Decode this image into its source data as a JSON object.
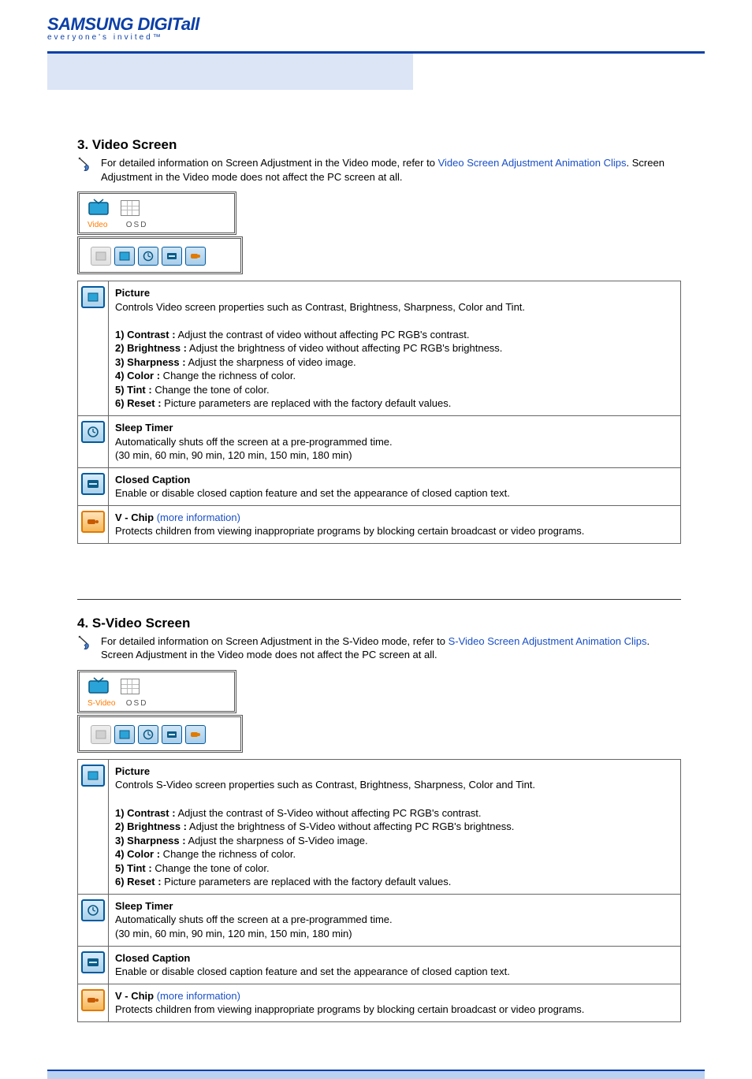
{
  "brand": {
    "logo_main": "SAMSUNG DIGITall",
    "logo_tag": "everyone's invited™"
  },
  "sections": [
    {
      "index": "3",
      "title": "Video Screen",
      "note_pre": "For detailed information on Screen Adjustment in the Video mode, refer to ",
      "note_link": "Video Screen Adjustment Animation Clips",
      "note_post": ". Screen Adjustment in the Video mode does not affect the PC screen at all.",
      "mode_label": "Video",
      "osd_label": "OSD",
      "features": {
        "picture": {
          "title": "Picture",
          "desc": "Controls Video screen properties such as Contrast, Brightness, Sharpness, Color and Tint.",
          "items": [
            {
              "label": "1) Contrast :",
              "text": " Adjust the contrast of video without affecting PC RGB's contrast."
            },
            {
              "label": "2) Brightness :",
              "text": " Adjust the brightness of video without affecting PC RGB's brightness."
            },
            {
              "label": "3) Sharpness :",
              "text": " Adjust the sharpness of video image."
            },
            {
              "label": "4) Color :",
              "text": " Change the richness of color."
            },
            {
              "label": "5) Tint :",
              "text": " Change the tone of color."
            },
            {
              "label": "6) Reset :",
              "text": " Picture parameters are replaced with the factory default values."
            }
          ]
        },
        "sleep": {
          "title": "Sleep Timer",
          "line1": "Automatically shuts off the screen at a pre-programmed time.",
          "line2": "(30 min, 60 min, 90 min, 120 min, 150 min, 180 min)"
        },
        "cc": {
          "title": "Closed Caption",
          "desc": "Enable or disable closed caption feature and set the appearance of closed caption text."
        },
        "vchip": {
          "title": "V - Chip ",
          "more": "(more information)",
          "desc": "Protects children from viewing inappropriate programs by blocking certain broadcast or video programs."
        }
      }
    },
    {
      "index": "4",
      "title": "S-Video Screen",
      "note_pre": "For detailed information on Screen Adjustment in the S-Video mode, refer to ",
      "note_link": "S-Video Screen Adjustment Animation Clips",
      "note_post": ". Screen Adjustment in the Video mode does not affect the PC screen at all.",
      "mode_label": "S-Video",
      "osd_label": "OSD",
      "features": {
        "picture": {
          "title": "Picture",
          "desc": "Controls S-Video screen properties such as Contrast, Brightness, Sharpness, Color and Tint.",
          "items": [
            {
              "label": "1) Contrast :",
              "text": " Adjust the contrast of S-Video without affecting PC RGB's contrast."
            },
            {
              "label": "2) Brightness :",
              "text": " Adjust the brightness of S-Video without affecting PC RGB's brightness."
            },
            {
              "label": "3) Sharpness :",
              "text": " Adjust the sharpness of S-Video image."
            },
            {
              "label": "4) Color :",
              "text": " Change the richness of color."
            },
            {
              "label": "5) Tint :",
              "text": " Change the tone of color."
            },
            {
              "label": "6) Reset :",
              "text": " Picture parameters are replaced with the factory default values."
            }
          ]
        },
        "sleep": {
          "title": "Sleep Timer",
          "line1": "Automatically shuts off the screen at a pre-programmed time.",
          "line2": "(30 min, 60 min, 90 min, 120 min, 150 min, 180 min)"
        },
        "cc": {
          "title": "Closed Caption",
          "desc": "Enable or disable closed caption feature and set the appearance of closed caption text."
        },
        "vchip": {
          "title": "V - Chip ",
          "more": "(more information)",
          "desc": "Protects children from viewing inappropriate programs by blocking certain broadcast or video programs."
        }
      }
    }
  ]
}
